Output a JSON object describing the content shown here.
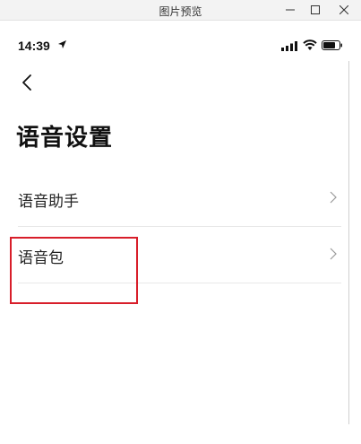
{
  "window": {
    "title": "图片预览",
    "controls": [
      "minimize-icon",
      "maximize-icon",
      "close-icon"
    ]
  },
  "status_bar": {
    "time": "14:39",
    "icons": [
      "location-arrow-icon",
      "signal-icon",
      "wifi-icon",
      "battery-icon"
    ]
  },
  "nav": {
    "back_icon": "chevron-left-icon"
  },
  "page": {
    "title": "语音设置"
  },
  "settings": {
    "items": [
      {
        "label": "语音助手",
        "icon": "chevron-right-icon"
      },
      {
        "label": "语音包",
        "icon": "chevron-right-icon"
      }
    ]
  },
  "colors": {
    "highlight": "#d81e2a",
    "divider": "#e8e8e8",
    "titlebar": "#f3f3f3"
  }
}
